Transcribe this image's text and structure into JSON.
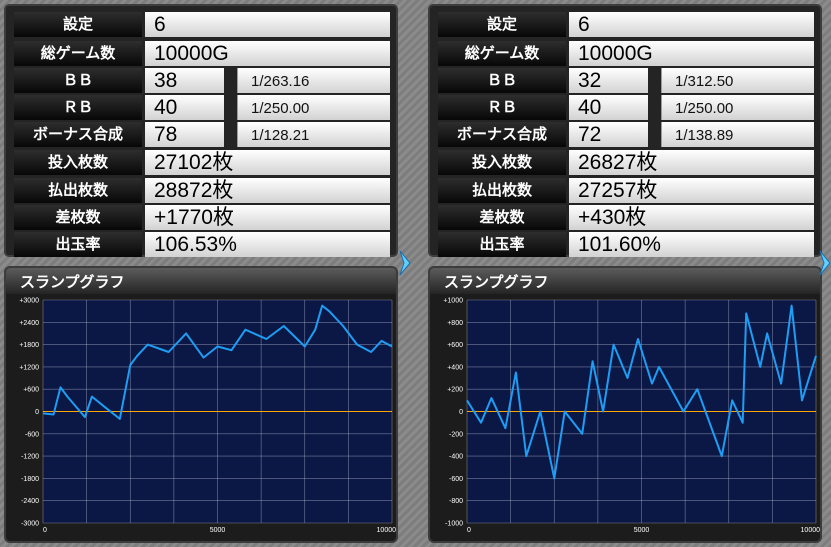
{
  "panels": [
    {
      "settings_label": "設定",
      "settings_value": "6",
      "games_label": "総ゲーム数",
      "games_value": "10000G",
      "bb_label": "ＢＢ",
      "bb_value": "38",
      "bb_prob": "1/263.16",
      "rb_label": "ＲＢ",
      "rb_value": "40",
      "rb_prob": "1/250.00",
      "bonus_label": "ボーナス合成",
      "bonus_value": "78",
      "bonus_prob": "1/128.21",
      "in_label": "投入枚数",
      "in_value": "27102枚",
      "out_label": "払出枚数",
      "out_value": "28872枚",
      "diff_label": "差枚数",
      "diff_value": "+1770枚",
      "rate_label": "出玉率",
      "rate_value": "106.53%",
      "graph_title": "スランプグラフ"
    },
    {
      "settings_label": "設定",
      "settings_value": "6",
      "games_label": "総ゲーム数",
      "games_value": "10000G",
      "bb_label": "ＢＢ",
      "bb_value": "32",
      "bb_prob": "1/312.50",
      "rb_label": "ＲＢ",
      "rb_value": "40",
      "rb_prob": "1/250.00",
      "bonus_label": "ボーナス合成",
      "bonus_value": "72",
      "bonus_prob": "1/138.89",
      "in_label": "投入枚数",
      "in_value": "26827枚",
      "out_label": "払出枚数",
      "out_value": "27257枚",
      "diff_label": "差枚数",
      "diff_value": "+430枚",
      "rate_label": "出玉率",
      "rate_value": "101.60%",
      "graph_title": "スランプグラフ"
    }
  ],
  "colors": {
    "line": "#1e9df4",
    "zero_line": "#ffa500",
    "grid": "#ccccdd",
    "plot_bg": "#0b1846"
  },
  "chart_data": [
    {
      "type": "line",
      "title": "スランプグラフ",
      "xlim": [
        0,
        10000
      ],
      "x_ticks": [
        "0",
        "5000",
        "10000"
      ],
      "ylim": [
        -3000,
        3000
      ],
      "y_ticks": [
        "+3000",
        "+2400",
        "+1800",
        "+1200",
        "+600",
        "0",
        "-600",
        "-1200",
        "-1800",
        "-2400",
        "-3000"
      ],
      "grid": true,
      "x": [
        0,
        300,
        500,
        700,
        1200,
        1400,
        1800,
        2200,
        2500,
        2700,
        3000,
        3600,
        4100,
        4600,
        5000,
        5400,
        5800,
        6400,
        6900,
        7500,
        7800,
        8000,
        8200,
        8600,
        9000,
        9400,
        9700,
        10000
      ],
      "values": [
        -50,
        -80,
        650,
        400,
        -150,
        400,
        100,
        -200,
        1250,
        1500,
        1800,
        1600,
        2100,
        1450,
        1750,
        1650,
        2200,
        1950,
        2300,
        1750,
        2200,
        2850,
        2700,
        2300,
        1800,
        1600,
        1900,
        1750
      ]
    },
    {
      "type": "line",
      "title": "スランプグラフ",
      "xlim": [
        0,
        10000
      ],
      "x_ticks": [
        "0",
        "5000",
        "10000"
      ],
      "ylim": [
        -1000,
        1000
      ],
      "y_ticks": [
        "+1000",
        "+800",
        "+600",
        "+400",
        "+200",
        "0",
        "-200",
        "-400",
        "-600",
        "-800",
        "-1000"
      ],
      "grid": true,
      "x": [
        0,
        400,
        700,
        1100,
        1400,
        1700,
        2100,
        2300,
        2500,
        2800,
        3300,
        3600,
        3900,
        4200,
        4600,
        4900,
        5300,
        5500,
        6200,
        6600,
        7300,
        7600,
        7900,
        8000,
        8400,
        8600,
        9000,
        9300,
        9600,
        10000
      ],
      "values": [
        100,
        -100,
        120,
        -150,
        350,
        -400,
        0,
        -300,
        -600,
        0,
        -200,
        450,
        0,
        600,
        300,
        650,
        250,
        400,
        0,
        200,
        -400,
        100,
        -100,
        880,
        400,
        700,
        250,
        950,
        100,
        500
      ]
    }
  ]
}
